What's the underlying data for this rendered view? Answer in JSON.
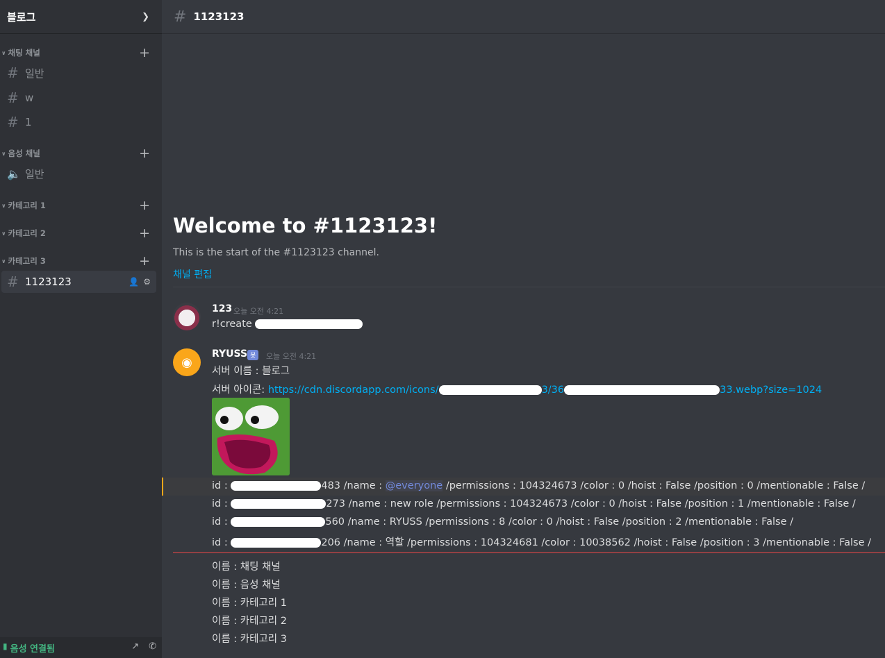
{
  "server": {
    "name": "블로그"
  },
  "sidebar": {
    "categories": [
      {
        "label": "채팅 채널",
        "channels": [
          "일반",
          "w",
          "1"
        ]
      },
      {
        "label": "음성 채널",
        "voice_channels": [
          "일반"
        ]
      },
      {
        "label": "카테고리 1"
      },
      {
        "label": "카테고리 2"
      },
      {
        "label": "카테고리 3",
        "channels": [
          "1123123"
        ]
      }
    ],
    "voice_status": "음성 연결됨"
  },
  "channel": {
    "name": "1123123",
    "welcome_title": "Welcome to #1123123!",
    "welcome_sub": "This is the start of the #1123123 channel.",
    "edit_link": "채널 편집"
  },
  "messages": [
    {
      "author": "123",
      "time": "오늘 오전 4:21",
      "text_prefix": "r!create"
    },
    {
      "author": "RYUSS",
      "bot_tag": "봇",
      "time": "오늘 오전 4:21",
      "server_name_line": "서버 이름 : 블로그",
      "icon_label": "서버 아이콘: ",
      "icon_link_a": "https://cdn.discordapp.com/icons/",
      "icon_link_b": "3/36",
      "icon_link_c": "33.webp?size=1024",
      "roles": [
        {
          "prefix": "id : ",
          "id_tail": "483",
          "rest_a": " /name : ",
          "mention": "@everyone",
          "rest_b": " /permissions : 104324673 /color : 0 /hoist : False /position : 0 /mentionable : False /"
        },
        {
          "prefix": "id : ",
          "id_tail": "273",
          "rest_a": " /name : new role /permissions : 104324673 /color : 0 /hoist : False /position : 1 /mentionable : False /",
          "mention": "",
          "rest_b": ""
        },
        {
          "prefix": "id : ",
          "id_tail": "560",
          "rest_a": " /name : RYUSS /permissions : 8 /color : 0 /hoist : False /position : 2 /mentionable : False /",
          "mention": "",
          "rest_b": ""
        },
        {
          "prefix": "id : ",
          "id_tail": "206",
          "rest_a": " /name : 역할 /permissions : 104324681 /color : 10038562 /hoist : False /position : 3 /mentionable : False /",
          "mention": "",
          "rest_b": ""
        }
      ],
      "names": [
        "이름 : 채팅 채널",
        "이름 : 음성 채널",
        "이름 : 카테고리 1",
        "이름 : 카테고리 2",
        "이름 : 카테고리 3"
      ]
    }
  ]
}
